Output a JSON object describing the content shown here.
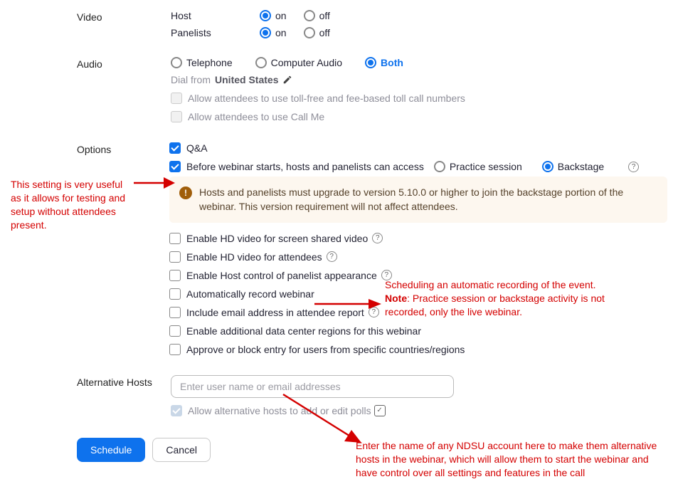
{
  "sections": {
    "video": {
      "label": "Video",
      "host_label": "Host",
      "panelists_label": "Panelists",
      "on": "on",
      "off": "off"
    },
    "audio": {
      "label": "Audio",
      "telephone": "Telephone",
      "computer": "Computer Audio",
      "both": "Both",
      "dial_prefix": "Dial from ",
      "dial_country": "United States",
      "allow_tollfree": "Allow attendees to use toll-free and fee-based toll call numbers",
      "allow_callme": "Allow attendees to use Call Me"
    },
    "options": {
      "label": "Options",
      "qa": "Q&A",
      "pre_access": "Before webinar starts, hosts and panelists can access",
      "practice": "Practice session",
      "backstage": "Backstage",
      "warn": "Hosts and panelists must upgrade to version 5.10.0 or higher to join the backstage portion of the webinar. This version requirement will not affect attendees.",
      "hd_screen": "Enable HD video for screen shared video",
      "hd_att": "Enable HD video for attendees",
      "host_ctrl": "Enable Host control of panelist appearance",
      "auto_rec": "Automatically record webinar",
      "email_rep": "Include email address in attendee report",
      "dc_regions": "Enable additional data center regions for this webinar",
      "approve_block": "Approve or block entry for users from specific countries/regions"
    },
    "alt_hosts": {
      "label": "Alternative Hosts",
      "placeholder": "Enter user name or email addresses",
      "allow_polls": "Allow alternative hosts to add or edit polls"
    }
  },
  "buttons": {
    "schedule": "Schedule",
    "cancel": "Cancel"
  },
  "annotations": {
    "a1": "This setting is very useful as it allows for testing and setup without attendees present.",
    "a2_line1": "Scheduling an automatic recording of the event.",
    "a2_note": "Note",
    "a2_rest": ": Practice session or backstage activity is not recorded, only the live webinar.",
    "a3": "Enter the name of any NDSU account here to make them alternative hosts in the webinar, which will allow them to start the webinar and have control over all settings and features in the call"
  }
}
